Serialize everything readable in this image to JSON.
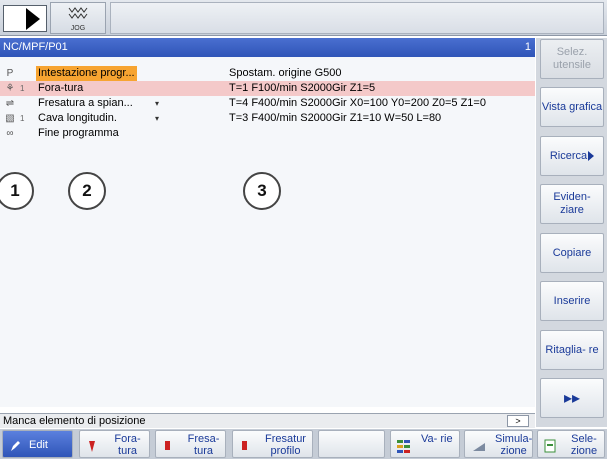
{
  "header": {
    "jog_label": "JOG"
  },
  "title": {
    "path": "NC/MPF/P01",
    "channel": "1"
  },
  "program": {
    "rows": [
      {
        "icon": "P",
        "level": "",
        "name": "Intestazione progr...",
        "expand": "",
        "params": "Spostam. origine G500"
      },
      {
        "icon": "⚘",
        "level": "1",
        "name": "Fora-tura",
        "expand": "",
        "params": "T=1 F100/min S2000Gir Z1=5"
      },
      {
        "icon": "⇌",
        "level": "",
        "name": "Fresatura a spian...",
        "expand": "▾",
        "params": "T=4 F400/min S2000Gir X0=100 Y0=200 Z0=5 Z1=0"
      },
      {
        "icon": "▧",
        "level": "1",
        "name": "Cava longitudin.",
        "expand": "▾",
        "params": "T=3 F400/min S2000Gir Z1=10 W=50 L=80"
      },
      {
        "icon": "∞",
        "level": "",
        "name": "Fine programma",
        "expand": "",
        "params": ""
      }
    ]
  },
  "markers": [
    "1",
    "2",
    "3"
  ],
  "status": {
    "message": "Manca elemento di posizione",
    "more": ">"
  },
  "vertical_softkeys": [
    {
      "label": "Selez. utensile",
      "enabled": false
    },
    {
      "label": "Vista grafica",
      "enabled": true
    },
    {
      "label": "Ricerca",
      "enabled": true,
      "arrow": true
    },
    {
      "label": "Eviden- ziare",
      "enabled": true
    },
    {
      "label": "Copiare",
      "enabled": true
    },
    {
      "label": "Inserire",
      "enabled": true
    },
    {
      "label": "Ritaglia- re",
      "enabled": true
    },
    {
      "label": "▸▸",
      "enabled": true
    }
  ],
  "horizontal_softkeys": [
    {
      "label": "Edit",
      "active": true
    },
    {
      "label": "Fora- tura",
      "active": false
    },
    {
      "label": "Fresa- tura",
      "active": false
    },
    {
      "label": "Fresatur profilo",
      "active": false
    },
    {
      "label": "",
      "active": false
    },
    {
      "label": "Va- rie",
      "active": false
    },
    {
      "label": "Simula- zione",
      "active": false
    },
    {
      "label": "Sele- zione",
      "active": false
    }
  ],
  "colors": {
    "title_blue": "#2f55b8",
    "selection_orange": "#f7a431",
    "error_row": "#f4c9c9",
    "softkey_text": "#1a3a99"
  }
}
